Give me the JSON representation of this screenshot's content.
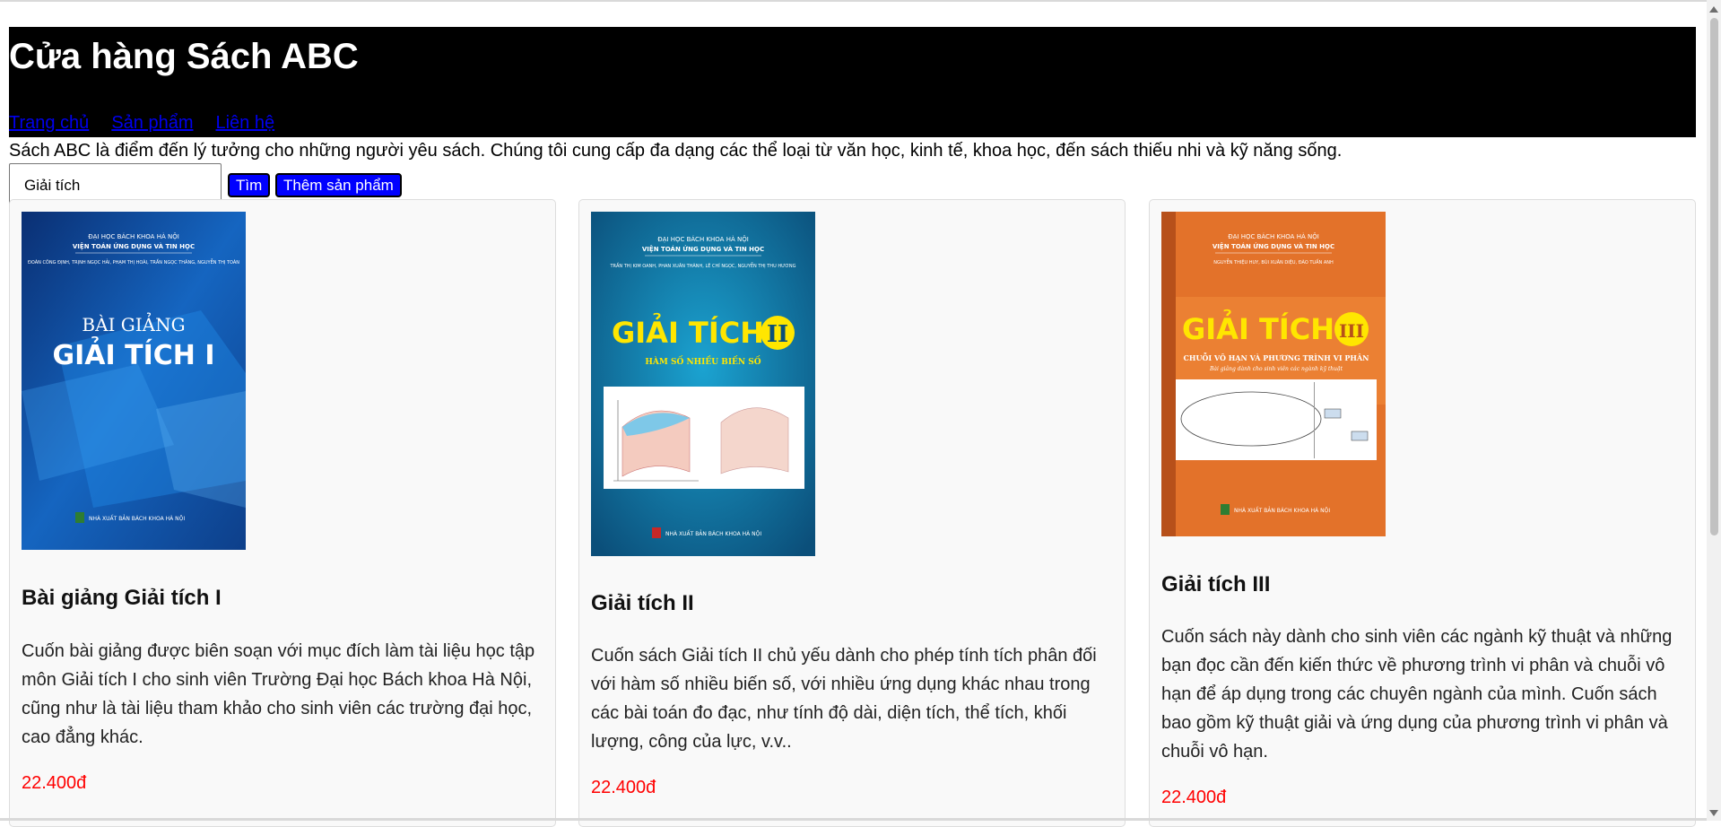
{
  "header": {
    "title": "Cửa hàng Sách ABC",
    "nav": [
      "Trang chủ",
      "Sản phẩm",
      "Liên hệ"
    ]
  },
  "intro": "Sách ABC là điểm đến lý tưởng cho những người yêu sách. Chúng tôi cung cấp đa dạng các thể loại từ văn học, kinh tế, khoa học, đến sách thiếu nhi và kỹ năng sống.",
  "search": {
    "value": "Giải tích"
  },
  "buttons": {
    "search": "Tìm",
    "add": "Thêm sản phẩm"
  },
  "products": [
    {
      "title": "Bài giảng Giải tích I",
      "description": "Cuốn bài giảng được biên soạn với mục đích làm tài liệu học tập môn Giải tích I cho sinh viên Trường Đại học Bách khoa Hà Nội, cũng như là tài liệu tham khảo cho sinh viên các trường đại học, cao đẳng khác.",
      "price": "22.400đ",
      "cover": {
        "publisher_line1": "ĐẠI HỌC BÁCH KHOA HÀ NỘI",
        "publisher_line2": "VIỆN TOÁN ỨNG DỤNG VÀ TIN HỌC",
        "authors": "ĐOÀN CÔNG ĐỊNH, TRỊNH NGỌC HẢI, PHẠM THỊ HOÀI, TRẦN NGỌC THĂNG, NGUYỄN THỊ TOÀN",
        "title_line1": "BÀI GIẢNG",
        "title_line2": "GIẢI TÍCH I",
        "press": "NHÀ XUẤT BẢN BÁCH KHOA HÀ NỘI"
      }
    },
    {
      "title": "Giải tích II",
      "description": "Cuốn sách Giải tích II chủ yếu dành cho phép tính tích phân đối với hàm số nhiều biến số, với nhiều ứng dụng khác nhau trong các bài toán đo đạc, như tính độ dài, diện tích, thể tích, khối lượng, công của lực, v.v..",
      "price": "22.400đ",
      "cover": {
        "publisher_line1": "ĐẠI HỌC BÁCH KHOA HÀ NỘI",
        "publisher_line2": "VIỆN TOÁN ỨNG DỤNG VÀ TIN HỌC",
        "authors": "TRẦN THỊ KIM OANH, PHAN XUÂN THÀNH, LÊ CHÍ NGỌC, NGUYỄN THỊ THU HƯƠNG",
        "title_line1": "GIẢI TÍCH",
        "numeral": "II",
        "subtitle": "HÀM SỐ NHIỀU BIẾN SỐ",
        "press": "NHÀ XUẤT BẢN BÁCH KHOA HÀ NỘI"
      }
    },
    {
      "title": "Giải tích III",
      "description": "Cuốn sách này dành cho sinh viên các ngành kỹ thuật và những bạn đọc cần đến kiến thức về phương trình vi phân và chuỗi vô hạn để áp dụng trong các chuyên ngành của mình. Cuốn sách bao gồm kỹ thuật giải và ứng dụng của phương trình vi phân và chuỗi vô hạn.",
      "price": "22.400đ",
      "cover": {
        "publisher_line1": "ĐẠI HỌC BÁCH KHOA HÀ NỘI",
        "publisher_line2": "VIỆN TOÁN ỨNG DỤNG VÀ TIN HỌC",
        "authors": "NGUYỄN THIỆU HUY, BÙI XUÂN DIỆU, ĐÀO TUẤN ANH",
        "title_line1": "GIẢI TÍCH",
        "numeral": "III",
        "subtitle": "CHUỖI VÔ HẠN VÀ PHƯƠNG TRÌNH VI PHÂN",
        "tagline": "Bài giảng dành cho sinh viên các ngành kỹ thuật",
        "press": "NHÀ XUẤT BẢN BÁCH KHOA HÀ NỘI"
      }
    }
  ]
}
